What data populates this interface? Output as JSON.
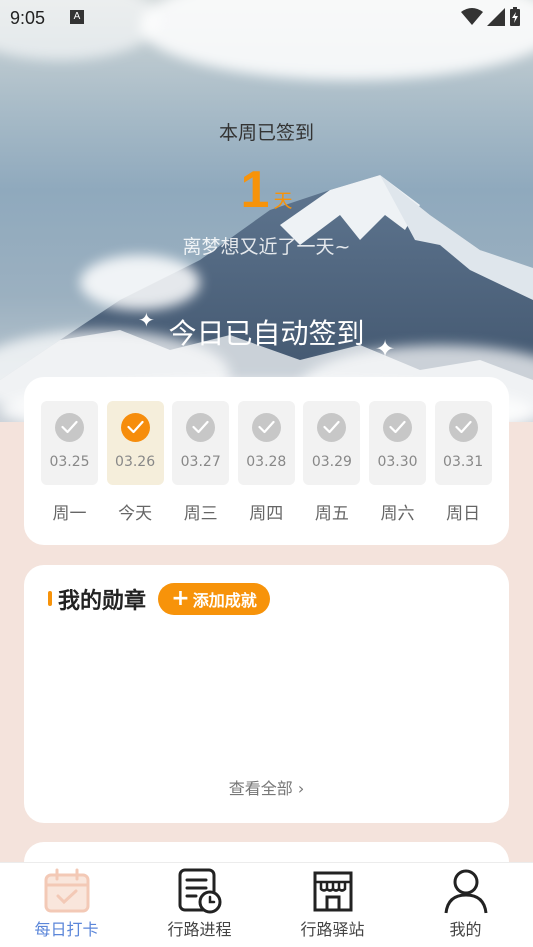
{
  "status_bar": {
    "time": "9:05",
    "notification_icon": "A"
  },
  "hero": {
    "week_title": "本周已签到",
    "days_count": "1",
    "days_unit": "天",
    "dream_text": "离梦想又近了一天~",
    "auto_sign_text": "今日已自动签到"
  },
  "week": {
    "days": [
      {
        "date": "03.25",
        "label": "周一",
        "today": false
      },
      {
        "date": "03.26",
        "label": "今天",
        "today": true
      },
      {
        "date": "03.27",
        "label": "周三",
        "today": false
      },
      {
        "date": "03.28",
        "label": "周四",
        "today": false
      },
      {
        "date": "03.29",
        "label": "周五",
        "today": false
      },
      {
        "date": "03.30",
        "label": "周六",
        "today": false
      },
      {
        "date": "03.31",
        "label": "周日",
        "today": false
      }
    ]
  },
  "badges": {
    "title": "我的勋章",
    "add_label": "添加成就",
    "view_all": "查看全部"
  },
  "tabbar": {
    "tabs": [
      {
        "label": "每日打卡",
        "icon": "calendar-check-icon",
        "active": true
      },
      {
        "label": "行路进程",
        "icon": "document-clock-icon",
        "active": false
      },
      {
        "label": "行路驿站",
        "icon": "store-icon",
        "active": false
      },
      {
        "label": "我的",
        "icon": "person-icon",
        "active": false
      }
    ]
  },
  "colors": {
    "accent": "#f7930a",
    "active_tab": "#5b86d9",
    "page_bg": "#f4e3dc"
  }
}
